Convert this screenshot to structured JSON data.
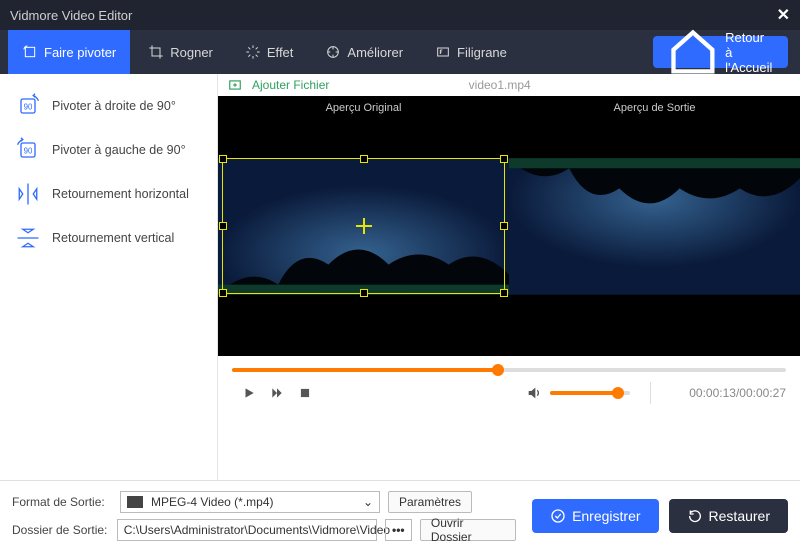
{
  "app": {
    "title": "Vidmore Video Editor"
  },
  "toolbar": {
    "tabs": [
      {
        "label": "Faire pivoter",
        "active": true
      },
      {
        "label": "Rogner"
      },
      {
        "label": "Effet"
      },
      {
        "label": "Améliorer"
      },
      {
        "label": "Filigrane"
      }
    ],
    "home": "Retour à l'Accueil"
  },
  "sidebar": {
    "items": [
      {
        "label": "Pivoter à droite de 90°"
      },
      {
        "label": "Pivoter à gauche de 90°"
      },
      {
        "label": "Retournement horizontal"
      },
      {
        "label": "Retournement vertical"
      }
    ]
  },
  "preview": {
    "add_file": "Ajouter Fichier",
    "file_name": "video1.mp4",
    "left_label": "Aperçu Original",
    "right_label": "Aperçu de Sortie",
    "timeline_progress_pct": 48,
    "volume_pct": 85,
    "timecode": "00:00:13/00:00:27"
  },
  "bottom": {
    "format_label": "Format de Sortie:",
    "format_value": "MPEG-4 Video (*.mp4)",
    "settings_btn": "Paramètres",
    "folder_label": "Dossier de Sortie:",
    "folder_value": "C:\\Users\\Administrator\\Documents\\Vidmore\\Video",
    "open_folder_btn": "Ouvrir Dossier",
    "save_btn": "Enregistrer",
    "restore_btn": "Restaurer"
  },
  "colors": {
    "accent": "#2f6bff",
    "orange": "#ff7a00",
    "crop": "#e6e600"
  }
}
